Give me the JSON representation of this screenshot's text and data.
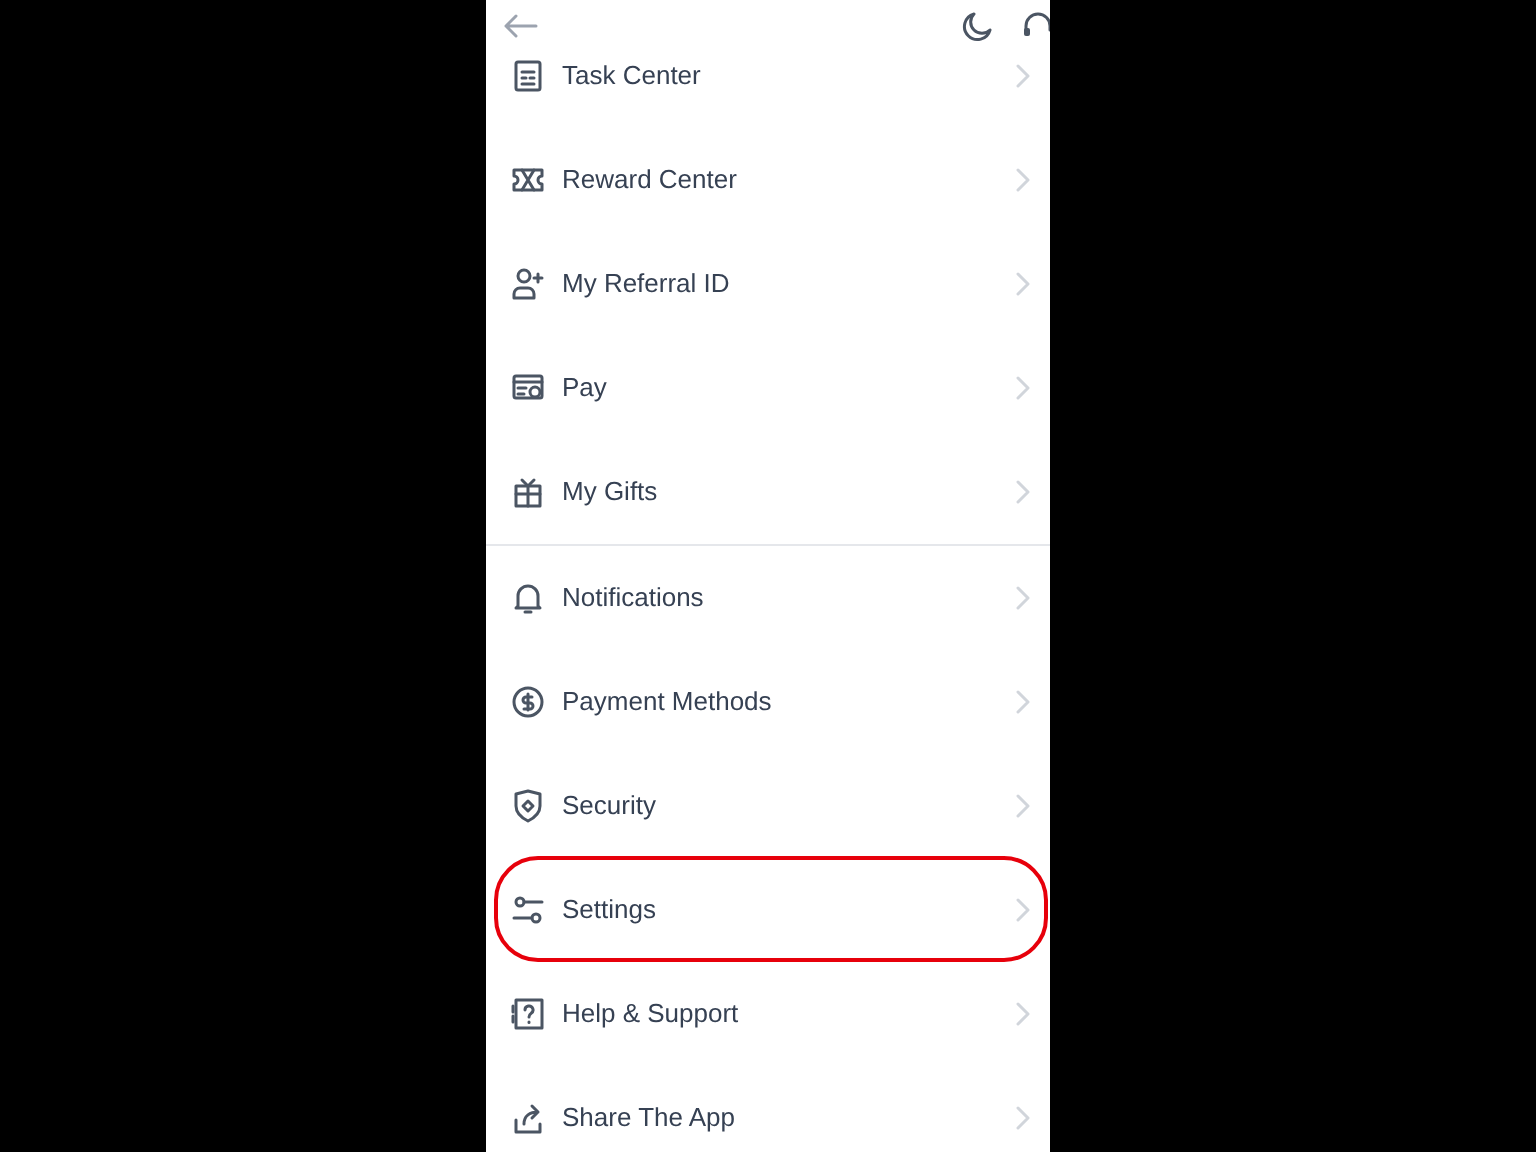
{
  "groups": [
    {
      "items": [
        {
          "kind": "tasks",
          "label": "Task Center",
          "highlighted": false
        },
        {
          "kind": "ticket",
          "label": "Reward Center",
          "highlighted": false
        },
        {
          "kind": "referral",
          "label": "My Referral ID",
          "highlighted": false
        },
        {
          "kind": "pay",
          "label": "Pay",
          "highlighted": false
        },
        {
          "kind": "gift",
          "label": "My Gifts",
          "highlighted": false
        }
      ]
    },
    {
      "items": [
        {
          "kind": "bell",
          "label": "Notifications",
          "highlighted": false
        },
        {
          "kind": "dollar",
          "label": "Payment Methods",
          "highlighted": false
        },
        {
          "kind": "shield",
          "label": "Security",
          "highlighted": false
        },
        {
          "kind": "sliders",
          "label": "Settings",
          "highlighted": true
        },
        {
          "kind": "help",
          "label": "Help & Support",
          "highlighted": false
        },
        {
          "kind": "share",
          "label": "Share The App",
          "highlighted": false
        }
      ]
    }
  ]
}
